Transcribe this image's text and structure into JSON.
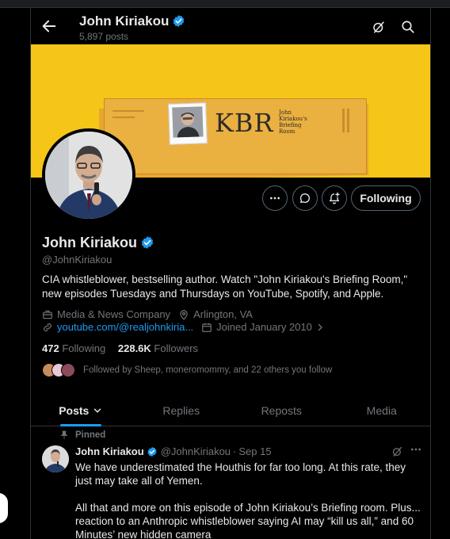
{
  "header": {
    "name": "John Kiriakou",
    "posts_count": "5,897 posts"
  },
  "banner": {
    "brand_text": "KBR",
    "brand_sub": "John Kiriakou's Briefing Room"
  },
  "actions": {
    "follow_label": "Following"
  },
  "profile": {
    "name": "John Kiriakou",
    "handle": "@JohnKiriakou",
    "bio": "CIA whistleblower, bestselling author. Watch \"John Kiriakou's Briefing Room,\" new episodes Tuesdays and Thursdays on YouTube, Spotify, and Apple.",
    "category": "Media & News Company",
    "location": "Arlington, VA",
    "website": "youtube.com/@realjohnkiria...",
    "joined": "Joined January 2010",
    "following_count": "472",
    "following_label": "Following",
    "followers_count": "228.6K",
    "followers_label": "Followers",
    "followed_by": "Followed by Sheep, moneromommy, and 22 others you follow"
  },
  "tabs": [
    {
      "label": "Posts"
    },
    {
      "label": "Replies"
    },
    {
      "label": "Reposts"
    },
    {
      "label": "Media"
    }
  ],
  "pinned_post": {
    "pinned_label": "Pinned",
    "author_name": "John Kiriakou",
    "author_handle": "@JohnKiriakou",
    "date": "Sep 15",
    "paragraph_1": "We have underestimated the Houthis for far too long. At this rate, they just may take all of Yemen.",
    "paragraph_2": "All that and more on this episode of John Kiriakou’s Briefing room. Plus... reaction to an Anthropic whistleblower saying AI may “kill us all,” and 60 Minutes’ new hidden camera"
  },
  "colors": {
    "accent": "#1d9bf0",
    "banner": "#f5c518",
    "muted_text": "#71767b",
    "border": "#2f3336"
  }
}
